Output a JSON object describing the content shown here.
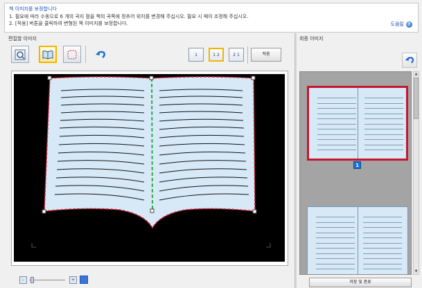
{
  "header": {
    "title": "책 이미지를 보정합니다",
    "line1": "1. 필요에 따라 수동으로 6 개의 곡지 점을 책의 곡쪽에 정추어 위치를 변경해 주십시오. 필요 시 페이 조정해 주십시오.",
    "line2": "2. [적용] 버튼을 클릭하여 변형된 책 이미지를 보정합니다.",
    "help_label": "도움말",
    "help_icon": "help-circle-icon"
  },
  "left_panel": {
    "label": "편집할 이미지",
    "tools": [
      {
        "name": "zoom-page-tool",
        "icon": "magnifier-page-icon"
      },
      {
        "name": "book-curve-tool",
        "icon": "book-curve-icon",
        "active": true
      },
      {
        "name": "free-curve-tool",
        "icon": "dotted-outline-icon"
      },
      {
        "name": "undo-tool",
        "icon": "undo-arrow-icon"
      }
    ],
    "page_modes": [
      {
        "label": "1",
        "active": false
      },
      {
        "label": "1 2",
        "active": true
      },
      {
        "label": "2 1",
        "active": false
      }
    ],
    "apply_label": "적용",
    "zoom_out_label": "-",
    "zoom_in_label": "+"
  },
  "right_panel": {
    "label": "최종 이미지",
    "page_badge": "1",
    "save_close_label": "저장 및 종료",
    "scroll_up": "▲",
    "scroll_down": "▼"
  },
  "colors": {
    "accent_blue": "#1d52b5",
    "page_fill": "#d7e9f7",
    "outline_red": "#d9233b",
    "center_green": "#2ea84a",
    "selected_border": "#c6162f"
  }
}
